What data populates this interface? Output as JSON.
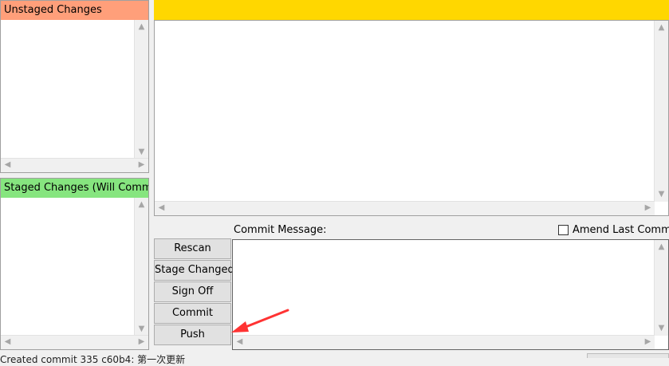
{
  "unstaged": {
    "header": "Unstaged Changes"
  },
  "staged": {
    "header": "Staged Changes (Will Commit)"
  },
  "commit_area": {
    "label": "Commit Message:",
    "amend_label": "Amend Last Commit",
    "buttons": [
      "Rescan",
      "Stage Changed",
      "Sign Off",
      "Commit",
      "Push"
    ]
  },
  "status": {
    "text": "Created commit 335 c60b4: 第一次更新"
  },
  "colors": {
    "unstaged_header": "#ff9f7a",
    "staged_header": "#86e57f",
    "diff_header": "#ffd700",
    "annotation_arrow": "#ff3333"
  },
  "icons": {
    "scroll_up": "▲",
    "scroll_down": "▼",
    "scroll_left": "◀",
    "scroll_right": "▶"
  }
}
